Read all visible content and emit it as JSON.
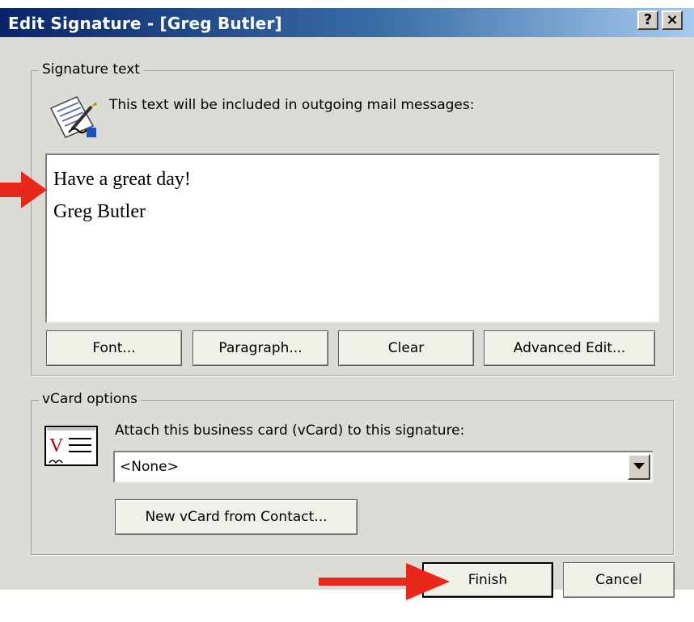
{
  "window": {
    "title": "Edit Signature - [Greg Butler]",
    "help_label": "?",
    "close_label": "×"
  },
  "signature": {
    "group_label": "Signature text",
    "description": "This text will be included in outgoing mail messages:",
    "text_lines": [
      "Have a great day!",
      "",
      "Greg Butler"
    ],
    "buttons": {
      "font": "Font...",
      "paragraph": "Paragraph...",
      "clear": "Clear",
      "advanced": "Advanced Edit..."
    }
  },
  "vcard": {
    "group_label": "vCard options",
    "description": "Attach this business card (vCard) to this signature:",
    "selected": "<None>",
    "new_button": "New vCard from Contact..."
  },
  "footer": {
    "finish": "Finish",
    "cancel": "Cancel"
  },
  "colors": {
    "annotation_arrow": "#e8281a",
    "dialog_bg": "#dcdcd6",
    "title_start": "#0a246a"
  }
}
